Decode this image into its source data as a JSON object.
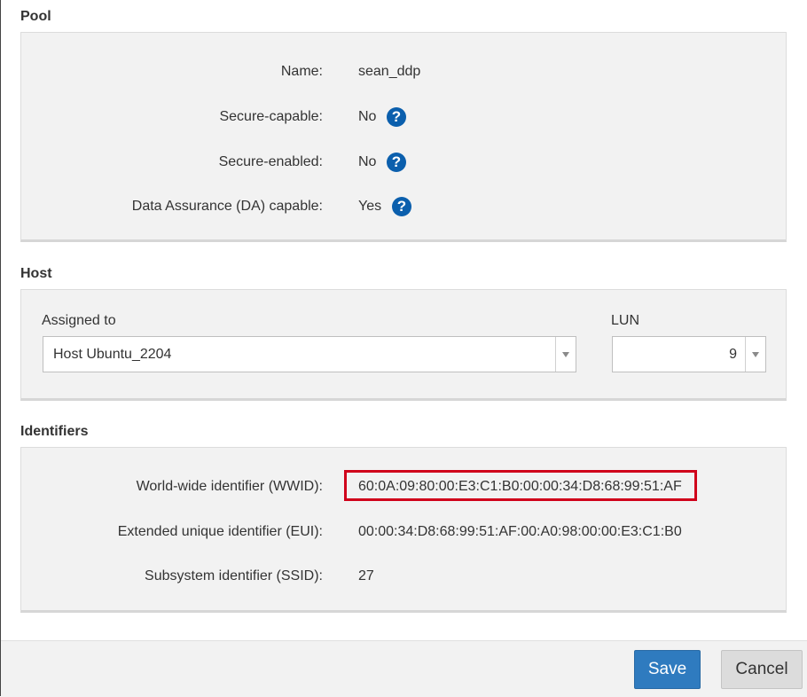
{
  "pool": {
    "title": "Pool",
    "rows": [
      {
        "label": "Name:",
        "value": "sean_ddp"
      },
      {
        "label": "Secure-capable:",
        "value": "No"
      },
      {
        "label": "Secure-enabled:",
        "value": "No"
      },
      {
        "label": "Data Assurance (DA) capable:",
        "value": "Yes"
      }
    ],
    "help_icon": "question-circle-icon"
  },
  "host": {
    "title": "Host",
    "assigned_label": "Assigned to",
    "assigned_value": "Host Ubuntu_2204",
    "lun_label": "LUN",
    "lun_value": "9"
  },
  "identifiers": {
    "title": "Identifiers",
    "rows": [
      {
        "label": "World-wide identifier (WWID):",
        "value": "60:0A:09:80:00:E3:C1:B0:00:00:34:D8:68:99:51:AF"
      },
      {
        "label": "Extended unique identifier (EUI):",
        "value": "00:00:34:D8:68:99:51:AF:00:A0:98:00:00:E3:C1:B0"
      },
      {
        "label": "Subsystem identifier (SSID):",
        "value": "27"
      }
    ],
    "highlight_color": "#d0021b"
  },
  "footer": {
    "save_label": "Save",
    "cancel_label": "Cancel"
  },
  "colors": {
    "accent": "#2f7bbf",
    "help_icon": "#0b5fad",
    "panel_bg": "#f2f2f2"
  }
}
